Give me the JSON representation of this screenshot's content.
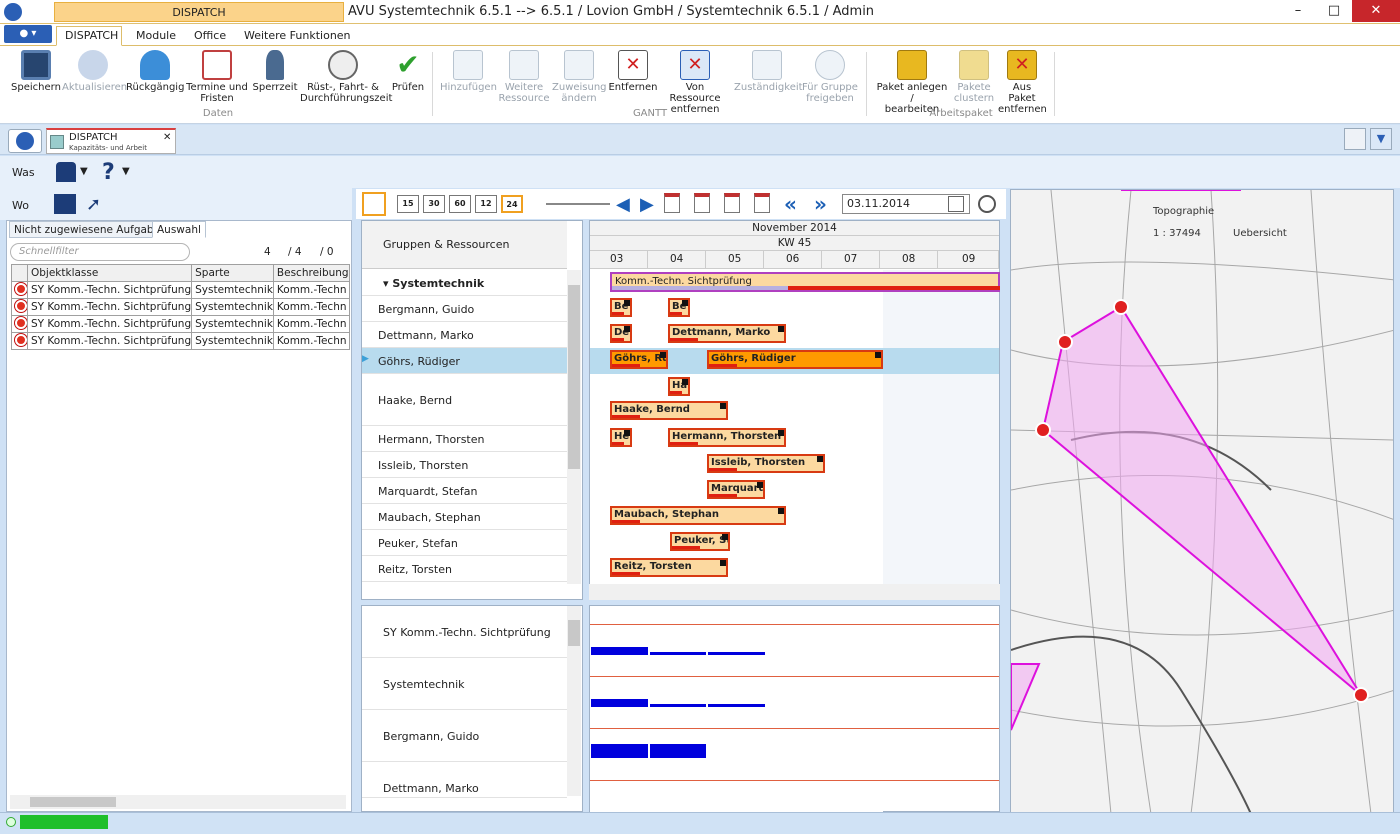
{
  "app": {
    "context_tab": "DISPATCH",
    "title": "AVU Systemtechnik 6.5.1 -->  6.5.1 / Lovion GmbH / Systemtechnik 6.5.1 / Admin"
  },
  "ribbon": {
    "tabs": [
      "DISPATCH",
      "Module",
      "Office",
      "Weitere Funktionen"
    ],
    "groups": {
      "daten": "Daten",
      "gantt": "GANTT",
      "arbeitspaket": "Arbeitspaket"
    },
    "buttons": {
      "speichern": "Speichern",
      "aktualisieren": "Aktualisieren",
      "rueckgaengig": "Rückgängig",
      "termine_1": "Termine und",
      "termine_2": "Fristen",
      "sperrzeit": "Sperrzeit",
      "ruest_1": "Rüst-, Fahrt- &",
      "ruest_2": "Durchführungszeit",
      "pruefen": "Prüfen",
      "hinzufuegen": "Hinzufügen",
      "weitere_1": "Weitere",
      "weitere_2": "Ressource",
      "zuweisung_1": "Zuweisung",
      "zuweisung_2": "ändern",
      "entfernen": "Entfernen",
      "von_res_1": "Von Ressource",
      "von_res_2": "entfernen",
      "zustaendigkeit": "Zuständigkeit",
      "fuer_gruppe_1": "Für Gruppe",
      "fuer_gruppe_2": "freigeben",
      "paket_anlegen_1": "Paket anlegen /",
      "paket_anlegen_2": "bearbeiten",
      "pakete_clustern_1": "Pakete",
      "pakete_clustern_2": "clustern",
      "aus_paket_1": "Aus Paket",
      "aus_paket_2": "entfernen"
    }
  },
  "doc_tab": {
    "title": "DISPATCH",
    "subtitle": "Kapazitäts- und Arbeit"
  },
  "filterbar": {
    "was": "Was",
    "wo": "Wo"
  },
  "left": {
    "tabs": [
      "Nicht zugewiesene Aufgaben",
      "Auswahl"
    ],
    "filter_placeholder": "Schnellfilter",
    "counts": [
      "4",
      "/ 4",
      "/ 0"
    ],
    "columns": [
      "Objektklasse",
      "Sparte",
      "Beschreibung"
    ],
    "rows": [
      [
        "SY Komm.-Techn. Sichtprüfung",
        "Systemtechnik",
        "Komm.-Techn"
      ],
      [
        "SY Komm.-Techn. Sichtprüfung",
        "Systemtechnik",
        "Komm.-Techn"
      ],
      [
        "SY Komm.-Techn. Sichtprüfung",
        "Systemtechnik",
        "Komm.-Techn"
      ],
      [
        "SY Komm.-Techn. Sichtprüfung",
        "Systemtechnik",
        "Komm.-Techn"
      ]
    ]
  },
  "gantt": {
    "zoom_buttons": [
      "15",
      "30",
      "60",
      "12",
      "24"
    ],
    "date": "03.11.2014",
    "header_label": "Gruppen & Ressourcen",
    "month": "November 2014",
    "week": "KW 45",
    "days": [
      "03",
      "04",
      "05",
      "06",
      "07",
      "08",
      "09"
    ],
    "group": "Systemtechnik",
    "group_bar": "Komm.-Techn. Sichtprüfung",
    "resources": [
      "Bergmann, Guido",
      "Dettmann, Marko",
      "Göhrs, Rüdiger",
      "Haake, Bernd",
      "Hermann, Thorsten",
      "Issleib, Thorsten",
      "Marquardt, Stefan",
      "Maubach, Stephan",
      "Peuker, Stefan",
      "Reitz, Torsten"
    ],
    "bars": {
      "bergmann_a": "Be",
      "bergmann_b": "Be",
      "dettmann_a": "De",
      "dettmann_b": "Dettmann, Marko",
      "goehrs_a": "Göhrs, Rüdiger",
      "goehrs_b": "Göhrs, Rüdiger",
      "haake_a": "Ha",
      "haake_b": "Haake, Bernd",
      "hermann_a": "He",
      "hermann_b": "Hermann, Thorsten",
      "issleib": "Issleib, Thorsten",
      "marquardt": "Marquardt, Stefan",
      "maubach": "Maubach, Stephan",
      "peuker": "Peuker, Stefan",
      "reitz": "Reitz, Torsten"
    }
  },
  "capacity": {
    "rows": [
      "SY Komm.-Techn. Sichtprüfung",
      "Systemtechnik",
      "Bergmann, Guido",
      "Dettmann, Marko"
    ]
  },
  "map": {
    "layer": "Topographie",
    "scale": "1 : 37494",
    "overview": "Uebersicht"
  },
  "colors": {
    "accent": "#ffa500",
    "ribbon_gold": "#fbd38a",
    "bar_fill": "#fcd9a0",
    "bar_border": "#d83a12",
    "selected_row": "#b8dbee",
    "capacity_bar": "#0000dd",
    "route": "#e020e0"
  }
}
